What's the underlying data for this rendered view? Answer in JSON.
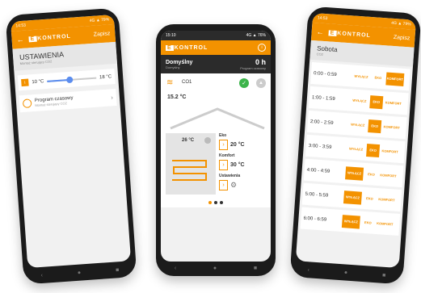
{
  "colors": {
    "accent": "#f39200",
    "green": "#3cb44b",
    "dark": "#2b2b2b"
  },
  "left": {
    "status_time": "14:53",
    "status_right": "4G ▲ 79%",
    "logo": "KONTROL",
    "save": "Zapisz",
    "title": "USTAWIENIA",
    "subtitle": "Montaż sterujący CO2",
    "temp_left": "10 °C",
    "temp_right": "18 °C",
    "program_label": "Program czasowy",
    "program_sub": "Montaż sterujący CO2"
  },
  "middle": {
    "status_time": "15:10",
    "status_right": "4G ▲ 76%",
    "logo": "KONTROL",
    "mode_title": "Domyślny",
    "mode_sub": "Domyślny",
    "hours": "0 h",
    "hours_sub": "Program czasowy",
    "zone_name": "CO1",
    "zone_temp": "15.2 °C",
    "room_temp": "26 °C",
    "eko_label": "Eko",
    "eko_value": "20 °C",
    "komfort_label": "Komfort",
    "komfort_value": "30 °C",
    "ustawienia_label": "Ustawienia"
  },
  "right": {
    "status_time": "14:53",
    "status_right": "4G ▲ 79%",
    "logo": "KONTROL",
    "save": "Zapisz",
    "day": "Sobota",
    "day_sub": "CO2",
    "rows": [
      {
        "time": "0:00 - 0:59",
        "wylacz": "WYŁĄCZ",
        "eko": "EKO",
        "komfort": "KOMFORT",
        "active": "komfort"
      },
      {
        "time": "1:00 - 1:59",
        "wylacz": "WYŁĄCZ",
        "eko": "EKO",
        "komfort": "KOMFORT",
        "active": "eko"
      },
      {
        "time": "2:00 - 2:59",
        "wylacz": "WYŁĄCZ",
        "eko": "EKO",
        "komfort": "KOMFORT",
        "active": "eko"
      },
      {
        "time": "3:00 - 3:59",
        "wylacz": "WYŁĄCZ",
        "eko": "EKO",
        "komfort": "KOMFORT",
        "active": "eko"
      },
      {
        "time": "4:00 - 4:59",
        "wylacz": "WYŁĄCZ",
        "eko": "EKO",
        "komfort": "KOMFORT",
        "active": "wylacz"
      },
      {
        "time": "5:00 - 5:59",
        "wylacz": "WYŁĄCZ",
        "eko": "EKO",
        "komfort": "KOMFORT",
        "active": "wylacz"
      },
      {
        "time": "6:00 - 6:59",
        "wylacz": "WYŁĄCZ",
        "eko": "EKO",
        "komfort": "KOMFORT",
        "active": "wylacz"
      }
    ]
  }
}
